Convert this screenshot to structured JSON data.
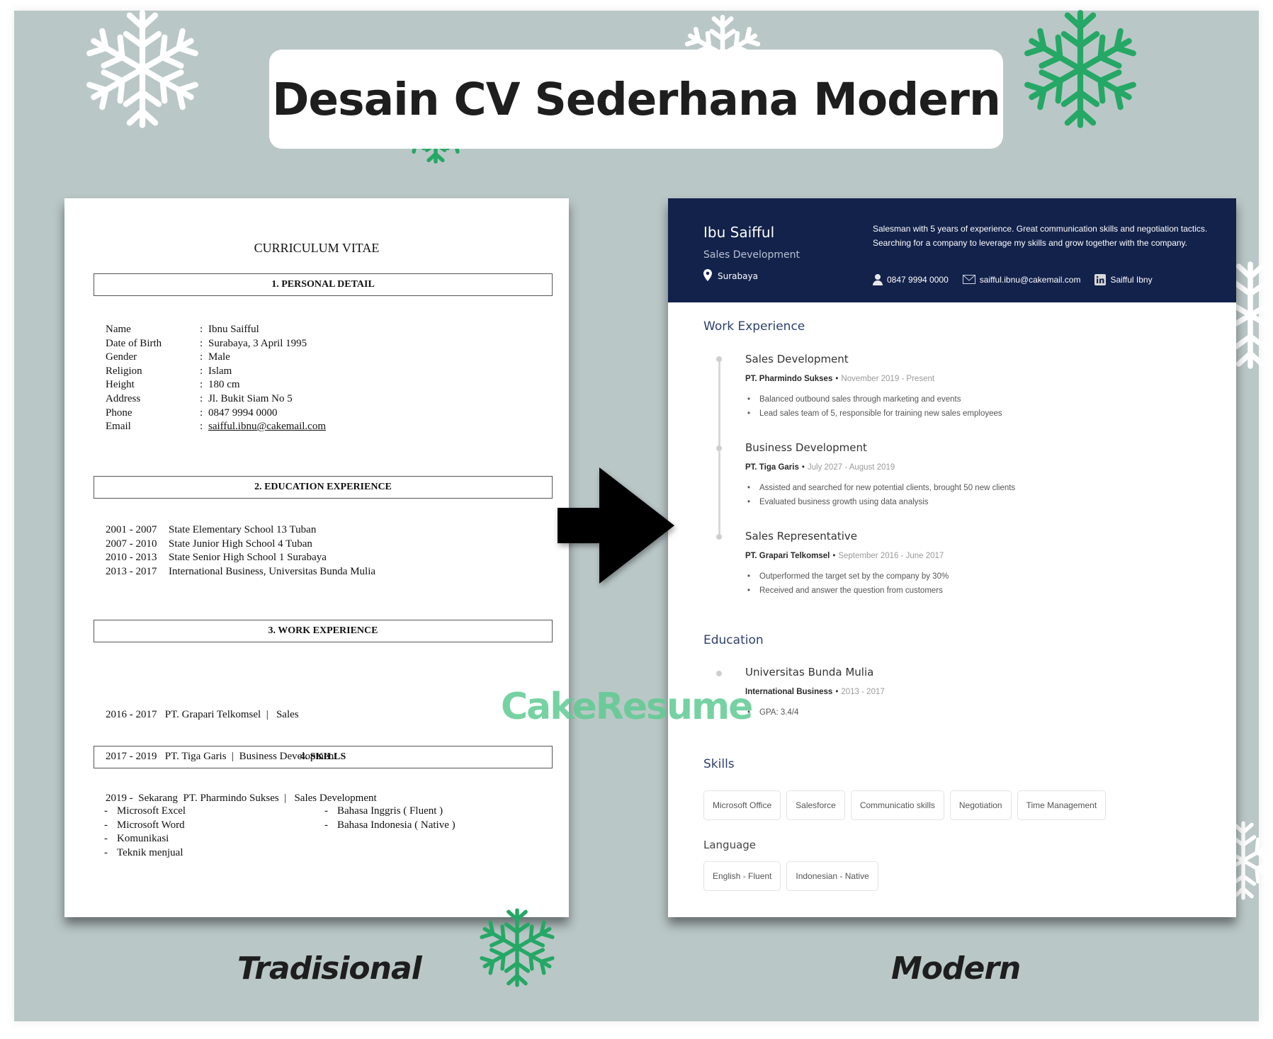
{
  "title": "Desain CV Sederhana Modern",
  "colors": {
    "background": "#bac7c7",
    "modern_header": "#13224b",
    "section_title": "#2d3f6e",
    "snowflake_white": "#ffffff",
    "snowflake_green": "#25a865",
    "watermark": "#5fcb92"
  },
  "labels": {
    "traditional": "Tradisional",
    "modern": "Modern"
  },
  "watermark": "CakeResume",
  "decorations": {
    "icons": [
      "snowflake-icon",
      "arrow-right-icon"
    ]
  },
  "traditional_cv": {
    "title": "CURRICULUM VITAE",
    "sections": {
      "personal": "1. PERSONAL DETAIL",
      "education": "2. EDUCATION EXPERIENCE",
      "work": "3. WORK EXPERIENCE",
      "skills": "4. SKILLS"
    },
    "personal_details": [
      {
        "label": "Name",
        "sep": ":",
        "value": "Ibnu Saifful"
      },
      {
        "label": "Date of Birth",
        "sep": ":",
        "value": "Surabaya, 3 April 1995"
      },
      {
        "label": "Gender",
        "sep": ":",
        "value": "Male"
      },
      {
        "label": "Religion",
        "sep": ":",
        "value": "Islam"
      },
      {
        "label": "Height",
        "sep": ":",
        "value": "180 cm"
      },
      {
        "label": "Address",
        "sep": ":",
        "value": "Jl. Bukit Siam No 5"
      },
      {
        "label": "Phone",
        "sep": ":",
        "value": "0847 9994 0000"
      },
      {
        "label": "Email",
        "sep": ":",
        "value": "saifful.ibnu@cakemail.com"
      }
    ],
    "education": [
      {
        "years": "2001 - 2007",
        "school": "State Elementary School 13 Tuban"
      },
      {
        "years": "2007 - 2010",
        "school": "State Junior High School 4 Tuban"
      },
      {
        "years": "2010 - 2013",
        "school": "State Senior High School 1 Surabaya"
      },
      {
        "years": "2013 - 2017",
        "school": "International Business, Universitas Bunda Mulia"
      }
    ],
    "work": [
      "2016 - 2017   PT. Grapari Telkomsel  |   Sales",
      "2017 - 2019   PT. Tiga Garis  |  Business Development",
      "2019 -  Sekarang  PT. Pharmindo Sukses  |   Sales Development"
    ],
    "skills_left": [
      "Microsoft Excel",
      "Microsoft Word",
      "Komunikasi",
      "Teknik menjual"
    ],
    "skills_right": [
      "Bahasa Inggris ( Fluent )",
      "Bahasa Indonesia ( Native )"
    ],
    "bullet": "-"
  },
  "modern_cv": {
    "name": "Ibu Saifful",
    "role": "Sales Development",
    "location": "Surabaya",
    "summary": "Salesman with 5 years of experience. Great communication skills and negotiation tactics. Searching for a company to leverage my skills and grow together with the company.",
    "contacts": {
      "phone": "0847 9994 0000",
      "email": "saifful.ibnu@cakemail.com",
      "linkedin": "Saifful Ibny"
    },
    "sections": {
      "work": "Work Experience",
      "education": "Education",
      "skills": "Skills",
      "language": "Language"
    },
    "separator": "•",
    "jobs": [
      {
        "title": "Sales Development",
        "company": "PT. Pharmindo Sukses",
        "dates": "November 2019 - Present",
        "bullets": [
          "Balanced outbound sales through marketing and events",
          "Lead sales team of 5, responsible for training new sales employees"
        ]
      },
      {
        "title": "Business Development",
        "company": "PT. Tiga Garis",
        "dates": "July 2027 - August 2019",
        "bullets": [
          "Assisted and searched for new potential clients, brought 50 new clients",
          "Evaluated business growth using data analysis"
        ]
      },
      {
        "title": "Sales Representative",
        "company": "PT. Grapari Telkomsel",
        "dates": "September 2016 - June 2017",
        "bullets": [
          "Outperformed the target set by the company by 30%",
          "Received and answer the question from customers"
        ]
      }
    ],
    "education": {
      "school": "Universitas Bunda Mulia",
      "major": "International Business",
      "dates": "2013 - 2017",
      "bullets": [
        "GPA: 3.4/4"
      ]
    },
    "skills": [
      "Microsoft Office",
      "Salesforce",
      "Communicatio skills",
      "Negotiation",
      "Time Management"
    ],
    "languages": [
      "English - Fluent",
      "Indonesian - Native"
    ],
    "bullet": "•"
  }
}
